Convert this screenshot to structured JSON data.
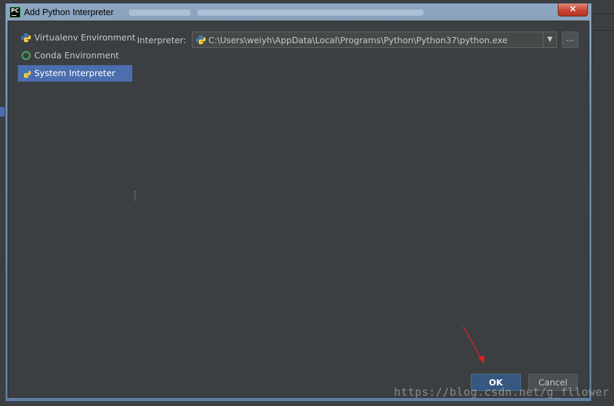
{
  "window": {
    "title": "Add Python Interpreter",
    "app_icon_text": "PC",
    "close_glyph": "×"
  },
  "sidebar": {
    "items": [
      {
        "label": "Virtualenv Environment",
        "icon": "python-icon",
        "selected": false
      },
      {
        "label": "Conda Environment",
        "icon": "conda-icon",
        "selected": false
      },
      {
        "label": "System Interpreter",
        "icon": "python-icon",
        "selected": true
      }
    ]
  },
  "interpreter": {
    "label": "Interpreter:",
    "value": "C:\\Users\\weiyh\\AppData\\Local\\Programs\\Python\\Python37\\python.exe",
    "browse_label": "...",
    "dropdown_glyph": "▼"
  },
  "buttons": {
    "ok": "OK",
    "cancel": "Cancel"
  },
  "watermark": "https://blog.csdn.net/g_fllower",
  "colors": {
    "background": "#3c3f41",
    "selection": "#4b6eaf",
    "ok_button": "#365880",
    "annotation_arrow": "#e02020"
  }
}
